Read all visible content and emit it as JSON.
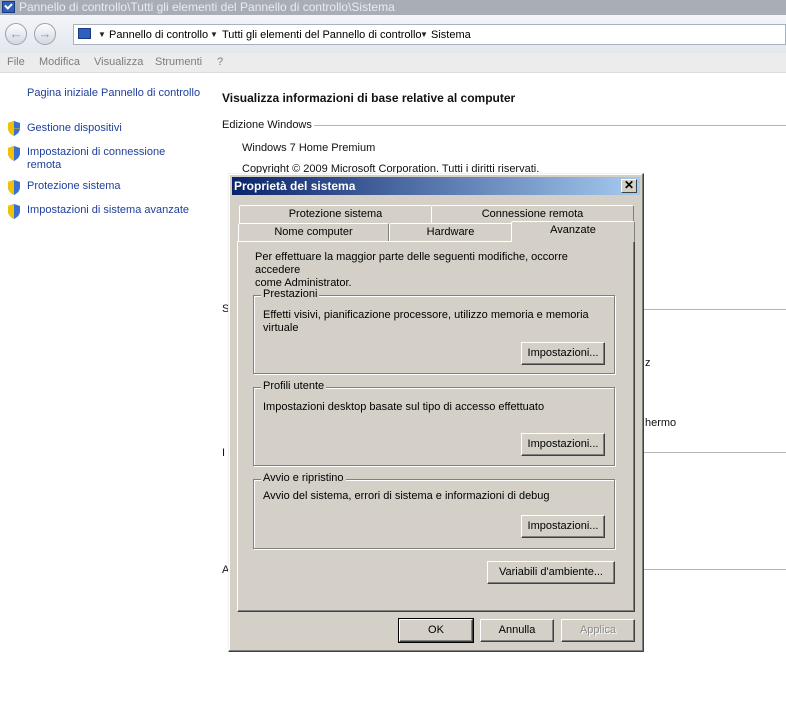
{
  "window": {
    "title": "Pannello di controllo\\Tutti gli elementi del Pannello di controllo\\Sistema"
  },
  "address": {
    "crumbs": [
      "Pannello di controllo",
      "Tutti gli elementi del Pannello di controllo",
      "Sistema"
    ]
  },
  "menu": {
    "items": [
      "File",
      "Modifica",
      "Visualizza",
      "Strumenti",
      "?"
    ]
  },
  "sidebar": {
    "home_link": "Pagina iniziale Pannello di controllo",
    "items": [
      {
        "label": "Gestione dispositivi"
      },
      {
        "label_line1": "Impostazioni di connessione",
        "label_line2": "remota"
      },
      {
        "label": "Protezione sistema"
      },
      {
        "label": "Impostazioni di sistema avanzate"
      }
    ]
  },
  "main": {
    "title": "Visualizza informazioni di base relative al computer",
    "edition_header": "Edizione Windows",
    "edition": "Windows 7 Home Premium",
    "copyright": "Copyright © 2009 Microsoft Corporation. Tutti i diritti riservati.",
    "hidden_fragments": {
      "s": "S",
      "z": "z",
      "schermo": "hermo",
      "i": "I",
      "a": "A"
    }
  },
  "dialog": {
    "title": "Proprietà del sistema",
    "close_glyph": "✕",
    "tabs_row1": [
      "Protezione sistema",
      "Connessione remota"
    ],
    "tabs_row2": [
      "Nome computer",
      "Hardware",
      "Avanzate"
    ],
    "active_tab": "Avanzate",
    "intro_line1": "Per effettuare la maggior parte delle seguenti modifiche, occorre accedere",
    "intro_line2": "come Administrator.",
    "groups": {
      "performance": {
        "legend": "Prestazioni",
        "text_line1": "Effetti visivi, pianificazione processore, utilizzo memoria e memoria",
        "text_line2": "virtuale",
        "button": "Impostazioni..."
      },
      "profiles": {
        "legend": "Profili utente",
        "text": "Impostazioni desktop basate sul tipo di accesso effettuato",
        "button": "Impostazioni..."
      },
      "startup": {
        "legend": "Avvio e ripristino",
        "text": "Avvio del sistema, errori di sistema e informazioni di debug",
        "button": "Impostazioni..."
      }
    },
    "env_button": "Variabili d'ambiente...",
    "ok_button": "OK",
    "cancel_button": "Annulla",
    "apply_button": "Applica"
  },
  "colors": {
    "link": "#1e3f9e",
    "dialog_face": "#d4d0c8",
    "title_gradient_start": "#0a246a",
    "title_gradient_end": "#a6caf0"
  }
}
